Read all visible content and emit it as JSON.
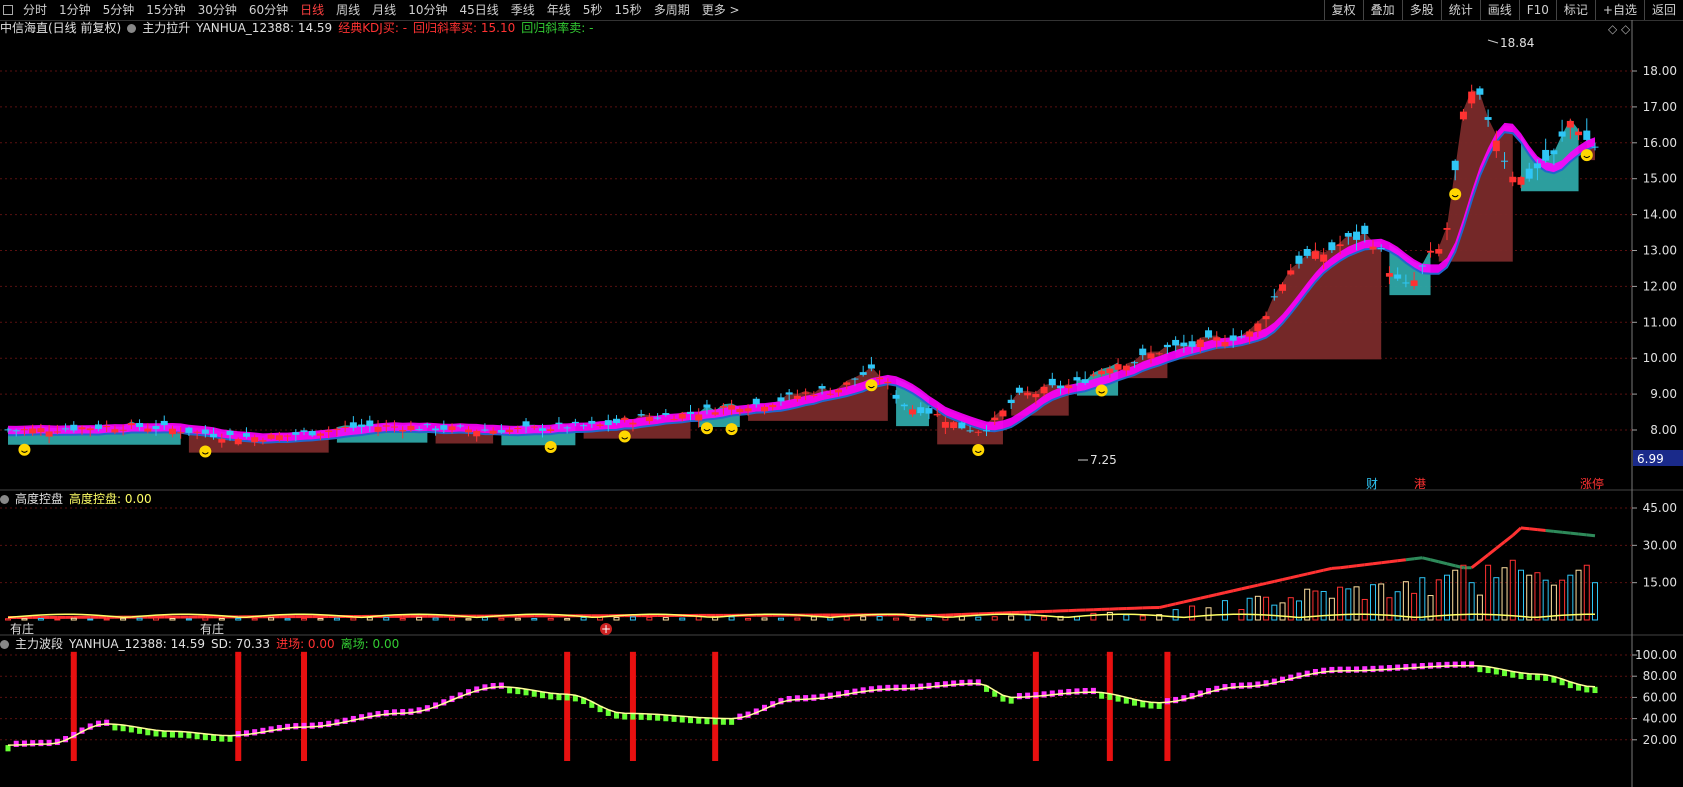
{
  "toolbar": {
    "periods": [
      "分时",
      "1分钟",
      "5分钟",
      "15分钟",
      "30分钟",
      "60分钟",
      "日线",
      "周线",
      "月线",
      "10分钟",
      "45日线",
      "季线",
      "年线",
      "5秒",
      "15秒",
      "多周期",
      "更多 >"
    ],
    "active_period": "日线",
    "right_buttons": [
      "复权",
      "叠加",
      "多股",
      "统计",
      "画线",
      "F10",
      "标记",
      "+自选",
      "返回"
    ]
  },
  "main_header": {
    "stock": "中信海直(日线 前复权)",
    "indicator": "主力拉升",
    "value_label": "YANHUA_12388: 14.59",
    "kdj_label": "经典KDJ买: -",
    "regress_buy_label": "回归斜率买: 15.10",
    "regress_sell_label": "回归斜率卖: -"
  },
  "main_annotations": {
    "high_label": "18.84",
    "low_label": "7.25",
    "current_price_tag": "6.99",
    "event_labels": [
      "财",
      "港",
      "涨停"
    ]
  },
  "panel2_header": {
    "name": "高度控盘",
    "value_label": "高度控盘: 0.00"
  },
  "panel2_bottom_labels": [
    "有庄",
    "有庄"
  ],
  "panel3_header": {
    "name": "主力波段",
    "value_label": "YANHUA_12388: 14.59",
    "sd_label": "SD: 70.33",
    "enter_label": "进场: 0.00",
    "exit_label": "离场: 0.00"
  },
  "colors": {
    "up": "#ff3232",
    "down": "#2fc6f6",
    "magenta": "#ff00ff",
    "maroon": "#7a2a2a",
    "teal": "#2ea6a6",
    "yellow": "#ffff66",
    "green": "#66ff33",
    "grid": "#5a1010",
    "axis": "#a0a0a0"
  },
  "chart_data": [
    {
      "type": "candlestick",
      "title": "中信海直(日线 前复权)",
      "y_ticks": [
        8.0,
        9.0,
        10.0,
        11.0,
        12.0,
        13.0,
        14.0,
        15.0,
        16.0,
        17.0,
        18.0
      ],
      "ylim": [
        7.0,
        19.0
      ],
      "range_high": 18.84,
      "range_low": 7.25,
      "key_points": [
        {
          "x": 0,
          "close": 8.0
        },
        {
          "x": 15,
          "close": 8.1
        },
        {
          "x": 30,
          "close": 7.8
        },
        {
          "x": 45,
          "close": 8.1
        },
        {
          "x": 60,
          "close": 8.0
        },
        {
          "x": 70,
          "close": 8.1
        },
        {
          "x": 80,
          "close": 8.4
        },
        {
          "x": 90,
          "close": 8.7
        },
        {
          "x": 100,
          "close": 9.1
        },
        {
          "x": 105,
          "close": 9.6
        },
        {
          "x": 110,
          "close": 8.6
        },
        {
          "x": 118,
          "close": 8.0
        },
        {
          "x": 124,
          "close": 9.0
        },
        {
          "x": 128,
          "close": 9.2
        },
        {
          "x": 136,
          "close": 9.9
        },
        {
          "x": 142,
          "close": 10.3
        },
        {
          "x": 150,
          "close": 10.6
        },
        {
          "x": 158,
          "close": 12.8
        },
        {
          "x": 165,
          "close": 13.4
        },
        {
          "x": 170,
          "close": 12.0
        },
        {
          "x": 174,
          "close": 13.0
        },
        {
          "x": 178,
          "close": 17.3
        },
        {
          "x": 184,
          "close": 15.0
        },
        {
          "x": 188,
          "close": 15.6
        },
        {
          "x": 190,
          "close": 16.6
        },
        {
          "x": 193,
          "close": 15.9
        }
      ]
    },
    {
      "type": "bar",
      "title": "高度控盘",
      "y_ticks": [
        15.0,
        30.0,
        45.0
      ],
      "ylim": [
        0,
        50
      ],
      "line_peak": 37,
      "line_end": 34,
      "bars_last_segment": [
        18,
        20,
        22,
        15,
        10,
        22,
        17,
        21,
        24,
        20,
        18,
        19,
        16,
        14,
        16
      ]
    },
    {
      "type": "line",
      "title": "主力波段",
      "y_ticks": [
        20.0,
        40.0,
        60.0,
        80.0,
        100.0
      ],
      "ylim": [
        0,
        110
      ],
      "smooth_key_points": [
        {
          "x": 0,
          "y": 15
        },
        {
          "x": 5,
          "y": 16
        },
        {
          "x": 12,
          "y": 35
        },
        {
          "x": 20,
          "y": 28
        },
        {
          "x": 27,
          "y": 24
        },
        {
          "x": 36,
          "y": 32
        },
        {
          "x": 48,
          "y": 45
        },
        {
          "x": 60,
          "y": 70
        },
        {
          "x": 68,
          "y": 63
        },
        {
          "x": 75,
          "y": 45
        },
        {
          "x": 88,
          "y": 40
        },
        {
          "x": 96,
          "y": 58
        },
        {
          "x": 108,
          "y": 68
        },
        {
          "x": 118,
          "y": 73
        },
        {
          "x": 122,
          "y": 60
        },
        {
          "x": 132,
          "y": 65
        },
        {
          "x": 140,
          "y": 55
        },
        {
          "x": 150,
          "y": 70
        },
        {
          "x": 162,
          "y": 85
        },
        {
          "x": 178,
          "y": 90
        },
        {
          "x": 186,
          "y": 82
        },
        {
          "x": 193,
          "y": 70
        }
      ],
      "signal_bar_indices": [
        8,
        28,
        36,
        68,
        76,
        86,
        125,
        134,
        141
      ]
    }
  ]
}
